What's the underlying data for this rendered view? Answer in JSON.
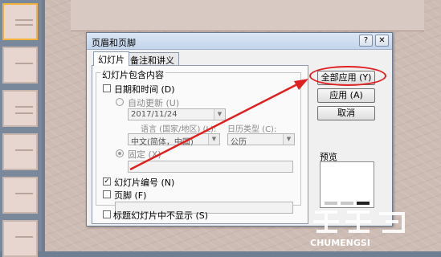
{
  "thumbnails": {
    "numbers": [
      "",
      "",
      "",
      "",
      "",
      "",
      ""
    ]
  },
  "dialog": {
    "title": "页眉和页脚",
    "help_icon": "?",
    "close_icon": "✕",
    "tabs": [
      {
        "label": "幻灯片",
        "active": true
      },
      {
        "label": "备注和讲义",
        "active": false
      }
    ],
    "group_title": "幻灯片包含内容",
    "date_time": {
      "label": "日期和时间 (D)",
      "checked": false
    },
    "auto_update": {
      "label": "自动更新 (U)",
      "selected": false
    },
    "date_value": "2017/11/24",
    "language_label": "语言 (国家/地区) (L):",
    "calendar_label": "日历类型 (C):",
    "language_value": "中文(简体，中国)",
    "calendar_value": "公历",
    "fixed": {
      "label": "固定 (X)",
      "selected": true
    },
    "fixed_value": "",
    "slide_number": {
      "label": "幻灯片编号 (N)",
      "checked": true
    },
    "footer": {
      "label": "页脚 (F)",
      "checked": false
    },
    "footer_value": "",
    "hide_on_title": {
      "label": "标题幻灯片中不显示 (S)",
      "checked": false
    },
    "buttons": {
      "apply_all": "全部应用 (Y)",
      "apply": "应用 (A)",
      "cancel": "取消"
    },
    "preview_label": "预览"
  },
  "watermark": {
    "brand": "CHUMENGSI"
  },
  "colors": {
    "highlight": "#e02020",
    "dialog_bg": "#f0f0f0",
    "slide_bg": "#cdbcb4"
  }
}
